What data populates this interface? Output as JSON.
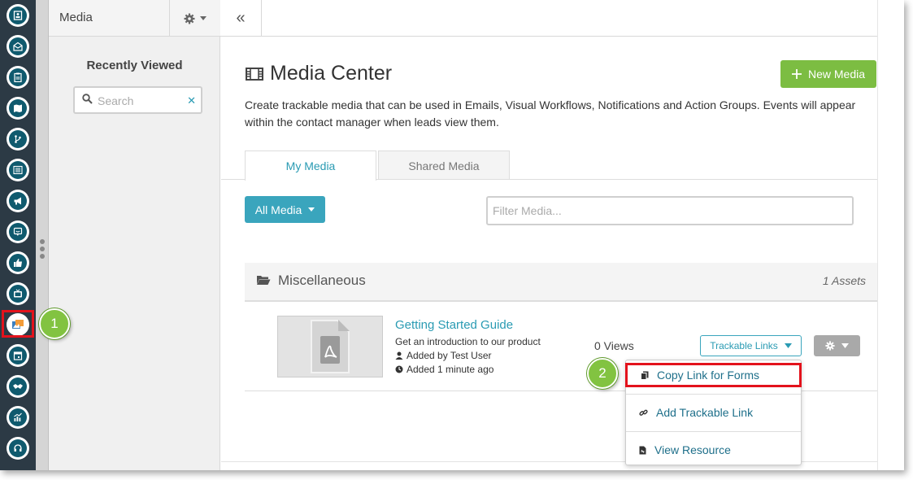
{
  "sidebar": {
    "title": "Media",
    "section_title": "Recently Viewed",
    "search": {
      "placeholder": "Search",
      "value": ""
    }
  },
  "main": {
    "title": "Media Center",
    "new_media_label": "New Media",
    "description": "Create trackable media that can be used in Emails, Visual Workflows, Notifications and Action Groups. Events will appear within the contact manager when leads view them.",
    "tabs": [
      {
        "label": "My Media",
        "active": true
      },
      {
        "label": "Shared Media",
        "active": false
      }
    ],
    "filter_button_label": "All Media",
    "filter": {
      "placeholder": "Filter Media...",
      "value": ""
    },
    "folder": {
      "name": "Miscellaneous",
      "asset_count": "1 Assets"
    },
    "asset": {
      "title": "Getting Started Guide",
      "subtitle": "Get an introduction to our product",
      "added_by": "Added by Test User",
      "added_time": "Added 1 minute ago",
      "views": "0 Views",
      "trackable_links_label": "Trackable Links"
    },
    "dropdown": {
      "items": [
        {
          "label": "Copy Link for Forms",
          "icon": "copy-icon"
        },
        {
          "label": "Add Trackable Link",
          "icon": "link-icon"
        },
        {
          "label": "View Resource",
          "icon": "file-icon"
        }
      ]
    }
  },
  "annotations": {
    "step1": "1",
    "step2": "2"
  },
  "rail_icons": [
    "contacts-icon",
    "email-icon",
    "clipboard-icon",
    "map-icon",
    "branch-icon",
    "list-icon",
    "megaphone-icon",
    "chat-icon",
    "thumbs-up-icon",
    "tv-icon",
    "media-icon",
    "calendar-icon",
    "handshake-icon",
    "chart-icon",
    "headset-icon"
  ],
  "colors": {
    "accent": "#2a9bb3",
    "primary_button": "#3aa5bd",
    "new_media_button": "#7cbd42",
    "highlight": "#e3121c",
    "badge": "#82c341",
    "rail": "#2c3a45"
  }
}
